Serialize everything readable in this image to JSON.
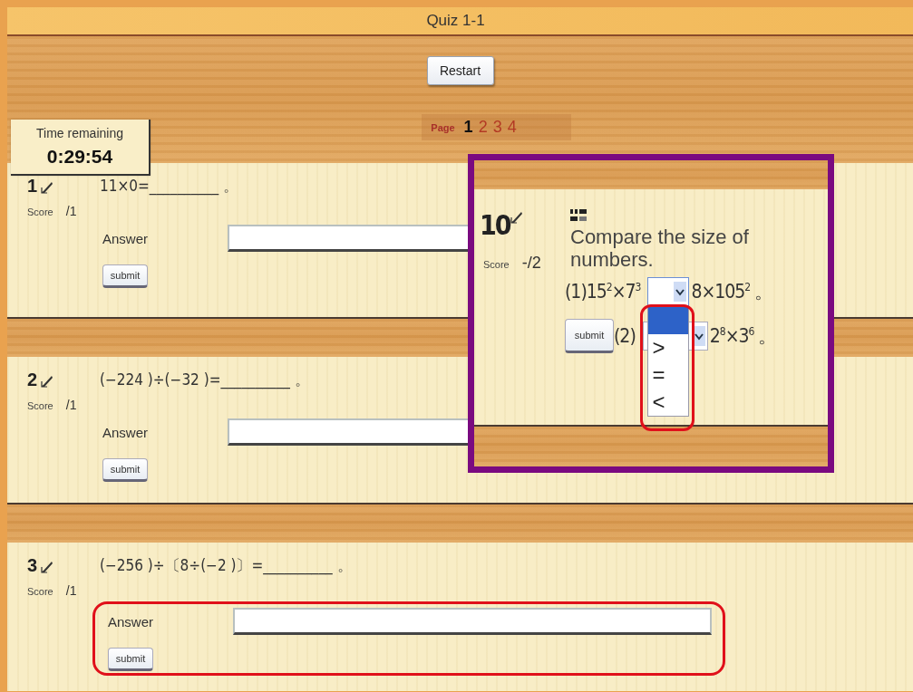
{
  "title": "Quiz 1-1",
  "restart": "Restart",
  "timer": {
    "label": "Time remaining",
    "value": "0:29:54"
  },
  "pager": {
    "label": "Page",
    "pages": [
      {
        "label": "1",
        "selected": true
      },
      {
        "label": "2",
        "selected": false
      },
      {
        "label": "3",
        "selected": false
      },
      {
        "label": "4",
        "selected": false
      }
    ]
  },
  "questions": [
    {
      "number": "1",
      "prompt": "11×0=__________ 。",
      "score_label": "Score",
      "score": "/1",
      "answer_label": "Answer",
      "submit": "submit",
      "highlighted": false
    },
    {
      "number": "2",
      "prompt": "(−224 )÷(−32 )=__________ 。",
      "score_label": "Score",
      "score": "/1",
      "answer_label": "Answer",
      "submit": "submit",
      "highlighted": false
    },
    {
      "number": "3",
      "prompt": "(−256 )÷〔8÷(−2 )〕=__________ 。",
      "score_label": "Score",
      "score": "/1",
      "answer_label": "Answer",
      "submit": "submit",
      "highlighted": true
    }
  ],
  "callout": {
    "number": "10",
    "score_label": "Score",
    "score": "-/2",
    "instruction": "Compare the size of numbers.",
    "submit": "submit",
    "items": [
      {
        "prefix": "(1)15$^{2}$×7$^{3}$",
        "suffix": "8×105$^{2}$ 。",
        "expanded": true,
        "highlighted": true,
        "options": [
          {
            "kind": "blank",
            "selected": true
          },
          {
            "kind": "text",
            "label": ">",
            "selected": false
          },
          {
            "kind": "text",
            "label": "=",
            "selected": false
          },
          {
            "kind": "text",
            "label": "<",
            "selected": false
          }
        ]
      },
      {
        "prefix": "(2)",
        "suffix": "2$^{8}$×3$^{6}$ 。",
        "expanded": false,
        "highlighted": false
      }
    ]
  }
}
